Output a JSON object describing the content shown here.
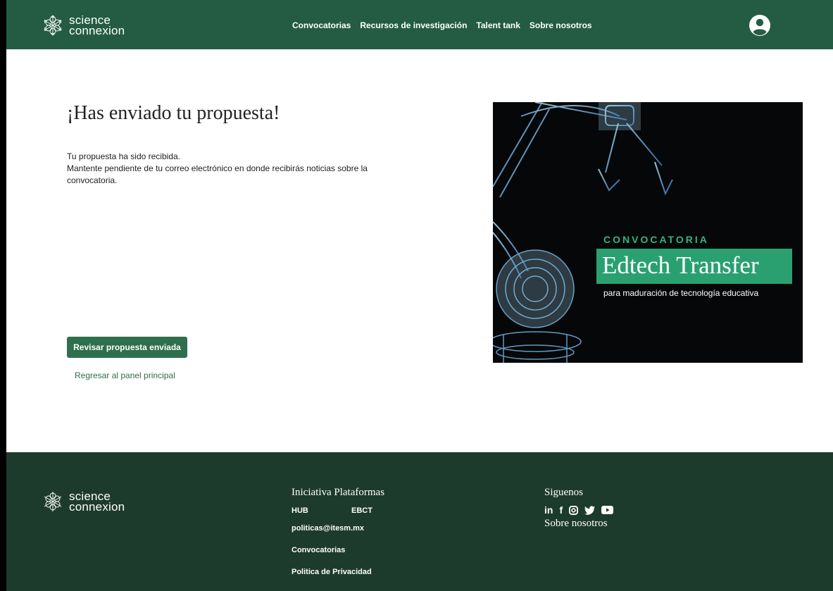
{
  "header": {
    "brand": {
      "line1": "science",
      "line2": "connexion"
    },
    "nav": [
      {
        "label": "Convocatorias"
      },
      {
        "label": "Recursos de investigación"
      },
      {
        "label": "Talent tank"
      },
      {
        "label": "Sobre nosotros"
      }
    ]
  },
  "main": {
    "title": "¡Has enviado tu propuesta!",
    "message_line1": "Tu propuesta ha sido recibida.",
    "message_line2": "Mantente pendiente de tu correo electrónico en donde recibirás noticias sobre la convocatoria.",
    "primary_button": "Revisar propuesta enviada",
    "back_link": "Regresar al panel principal"
  },
  "banner": {
    "label": "CONVOCATORIA",
    "title": "Edtech Transfer",
    "subtitle": "para maduración de tecnología educativa",
    "accent_color": "#2aa071"
  },
  "footer": {
    "brand": {
      "line1": "science",
      "line2": "connexion"
    },
    "col1_title": "Iniciativa Plataformas",
    "hub": "HUB",
    "ebct": "EBCT",
    "email": "politicas@itesm.mx",
    "convocatorias": "Convocatorias",
    "privacy": "Politica de Privacidad",
    "col2_title": "Siguenos",
    "about": "Sobre nosotros",
    "social_icons": [
      "linkedin-icon",
      "facebook-icon",
      "instagram-icon",
      "twitter-icon",
      "youtube-icon"
    ]
  },
  "colors": {
    "header_bg": "#235c43",
    "footer_bg": "#1c3b2c",
    "primary": "#2e6f4d"
  }
}
